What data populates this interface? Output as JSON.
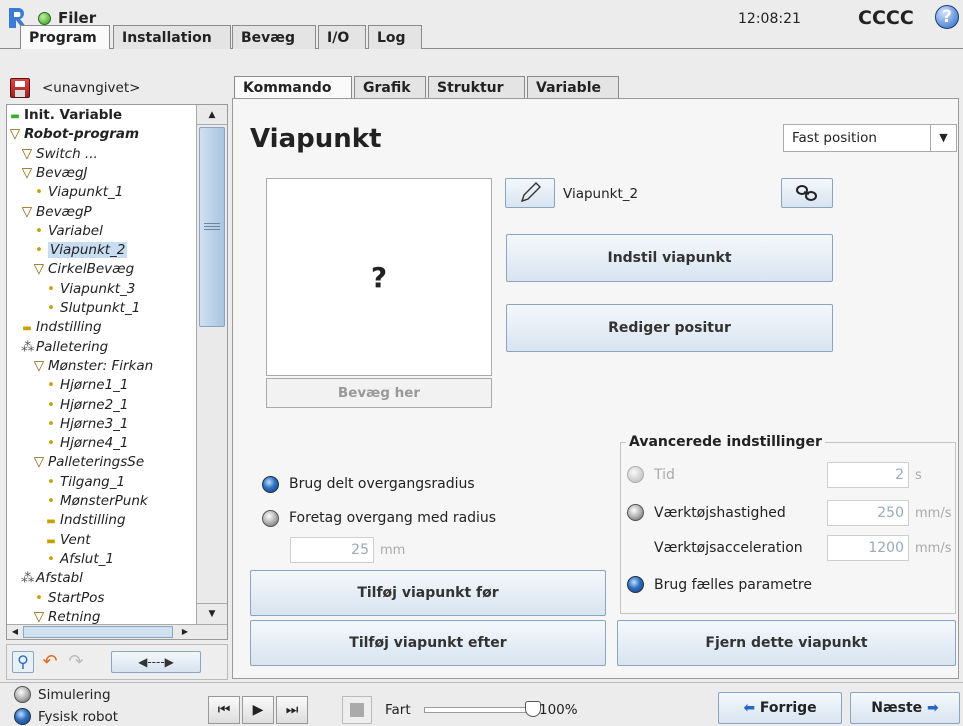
{
  "header": {
    "app_title": "Filer",
    "time": "12:08:21",
    "robot_name": "CCCC"
  },
  "main_tabs": [
    {
      "label": "Program",
      "active": true
    },
    {
      "label": "Installation",
      "active": false
    },
    {
      "label": "Bevæg",
      "active": false
    },
    {
      "label": "I/O",
      "active": false
    },
    {
      "label": "Log",
      "active": false
    }
  ],
  "file": {
    "name": "<unavngivet>"
  },
  "sub_tabs": [
    {
      "label": "Kommando",
      "active": true
    },
    {
      "label": "Grafik",
      "active": false
    },
    {
      "label": "Struktur",
      "active": false
    },
    {
      "label": "Variable",
      "active": false
    }
  ],
  "tree": [
    {
      "label": "Init. Variable",
      "level": 0,
      "icon": "green-dash",
      "bold": true,
      "italic": false
    },
    {
      "label": "Robot-program",
      "level": 0,
      "icon": "triangle",
      "bold": true,
      "italic": true
    },
    {
      "label": "Switch ...",
      "level": 1,
      "icon": "triangle"
    },
    {
      "label": "BevægJ",
      "level": 1,
      "icon": "triangle"
    },
    {
      "label": "Viapunkt_1",
      "level": 2,
      "icon": "dot"
    },
    {
      "label": "BevægP",
      "level": 1,
      "icon": "triangle"
    },
    {
      "label": "Variabel",
      "level": 2,
      "icon": "dot"
    },
    {
      "label": "Viapunkt_2",
      "level": 2,
      "icon": "dot",
      "selected": true
    },
    {
      "label": "CirkelBevæg",
      "level": 2,
      "icon": "triangle"
    },
    {
      "label": "Viapunkt_3",
      "level": 3,
      "icon": "dot"
    },
    {
      "label": "Slutpunkt_1",
      "level": 3,
      "icon": "dot"
    },
    {
      "label": "Indstilling",
      "level": 1,
      "icon": "dash"
    },
    {
      "label": "Palletering",
      "level": 1,
      "icon": "pallet"
    },
    {
      "label": "Mønster: Firkan",
      "level": 2,
      "icon": "triangle"
    },
    {
      "label": "Hjørne1_1",
      "level": 3,
      "icon": "dot"
    },
    {
      "label": "Hjørne2_1",
      "level": 3,
      "icon": "dot"
    },
    {
      "label": "Hjørne3_1",
      "level": 3,
      "icon": "dot"
    },
    {
      "label": "Hjørne4_1",
      "level": 3,
      "icon": "dot"
    },
    {
      "label": "PalleteringsSe",
      "level": 2,
      "icon": "triangle"
    },
    {
      "label": "Tilgang_1",
      "level": 3,
      "icon": "dot"
    },
    {
      "label": "MønsterPunk",
      "level": 3,
      "icon": "dot"
    },
    {
      "label": "Indstilling",
      "level": 3,
      "icon": "dash"
    },
    {
      "label": "Vent",
      "level": 3,
      "icon": "dash"
    },
    {
      "label": "Afslut_1",
      "level": 3,
      "icon": "dot"
    },
    {
      "label": "Afstabl",
      "level": 1,
      "icon": "pallet"
    },
    {
      "label": "StartPos",
      "level": 2,
      "icon": "dot"
    },
    {
      "label": "Retning",
      "level": 2,
      "icon": "triangle"
    }
  ],
  "waypoint": {
    "title": "Viapunkt",
    "position_type": "Fast position",
    "preview_symbol": "?",
    "move_here_label": "Bevæg her",
    "name": "Viapunkt_2",
    "set_waypoint_label": "Indstil viapunkt",
    "edit_pose_label": "Rediger positur",
    "blend_shared_label": "Brug delt overgangsradius",
    "blend_radius_label": "Foretag overgang med radius",
    "blend_radius_value": "25",
    "blend_radius_unit": "mm",
    "add_before_label": "Tilføj viapunkt før",
    "add_after_label": "Tilføj viapunkt efter",
    "remove_label": "Fjern dette viapunkt"
  },
  "advanced": {
    "title": "Avancerede indstillinger",
    "time_label": "Tid",
    "time_value": "2",
    "time_unit": "s",
    "tool_speed_label": "Værktøjshastighed",
    "tool_speed_value": "250",
    "tool_speed_unit": "mm/s",
    "tool_acc_label": "Værktøjsacceleration",
    "tool_acc_value": "1200",
    "tool_acc_unit": "mm/s",
    "shared_params_label": "Brug fælles parametre"
  },
  "footer": {
    "simulation_label": "Simulering",
    "real_robot_label": "Fysisk robot",
    "speed_label": "Fart",
    "speed_value": "100%",
    "speed_fraction": 1.0,
    "prev_label": "Forrige",
    "next_label": "Næste"
  },
  "colors": {
    "accent": "#2d6fc0",
    "selected_bg": "#c8dcf2",
    "button_border": "#8aa5bf"
  }
}
